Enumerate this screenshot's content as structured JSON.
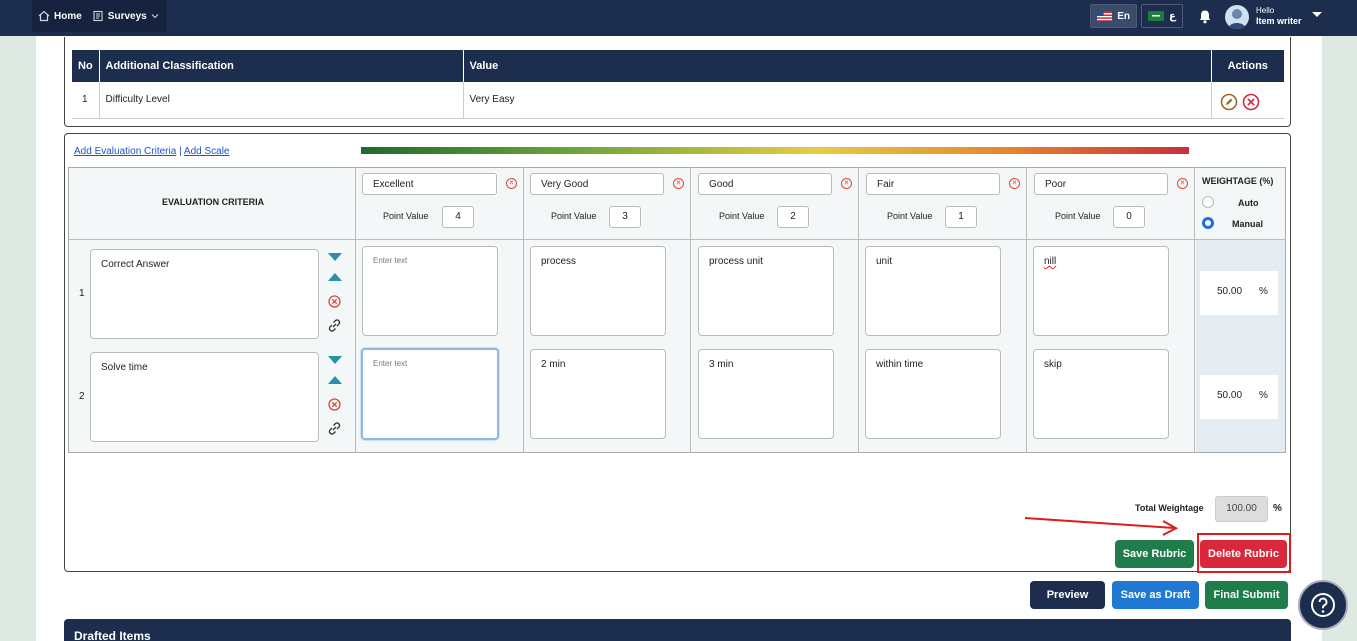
{
  "nav": {
    "home": "Home",
    "surveys": "Surveys"
  },
  "lang": {
    "en": "En",
    "ar": "ع"
  },
  "user": {
    "hello": "Hello",
    "name": "Item writer"
  },
  "classification_table": {
    "headers": [
      "No",
      "Additional Classification",
      "Value",
      "Actions"
    ],
    "rows": [
      {
        "no": "1",
        "classification": "Difficulty Level",
        "value": "Very Easy"
      }
    ]
  },
  "rubric": {
    "add_criteria": "Add Evaluation Criteria",
    "separator": "|",
    "add_scale": "Add Scale",
    "criteria_header": "EVALUATION CRITERIA",
    "point_label": "Point Value",
    "levels": [
      {
        "name": "Excellent",
        "points": "4"
      },
      {
        "name": "Very Good",
        "points": "3"
      },
      {
        "name": "Good",
        "points": "2"
      },
      {
        "name": "Fair",
        "points": "1"
      },
      {
        "name": "Poor",
        "points": "0"
      }
    ],
    "weightage_header": "WEIGHTAGE (%)",
    "auto": "Auto",
    "manual": "Manual",
    "placeholder": "Enter text",
    "criteria": [
      {
        "no": "1",
        "name": "Correct Answer",
        "cells": [
          "",
          "process",
          "process unit",
          "unit",
          "nill"
        ],
        "weight": "50.00"
      },
      {
        "no": "2",
        "name": "Solve time",
        "cells": [
          "",
          "2 min",
          "3 min",
          "within time",
          "skip"
        ],
        "weight": "50.00"
      }
    ],
    "pct": "%",
    "total_label": "Total Weightage",
    "total_value": "100.00",
    "save": "Save Rubric",
    "delete": "Delete Rubric"
  },
  "footer_buttons": {
    "preview": "Preview",
    "draft": "Save as Draft",
    "submit": "Final Submit"
  },
  "drafted": "Drafted Items",
  "colors": {
    "navy": "#1c2d4e",
    "green": "#1e7d4a",
    "red": "#d9283b",
    "blue": "#1f78d1"
  }
}
